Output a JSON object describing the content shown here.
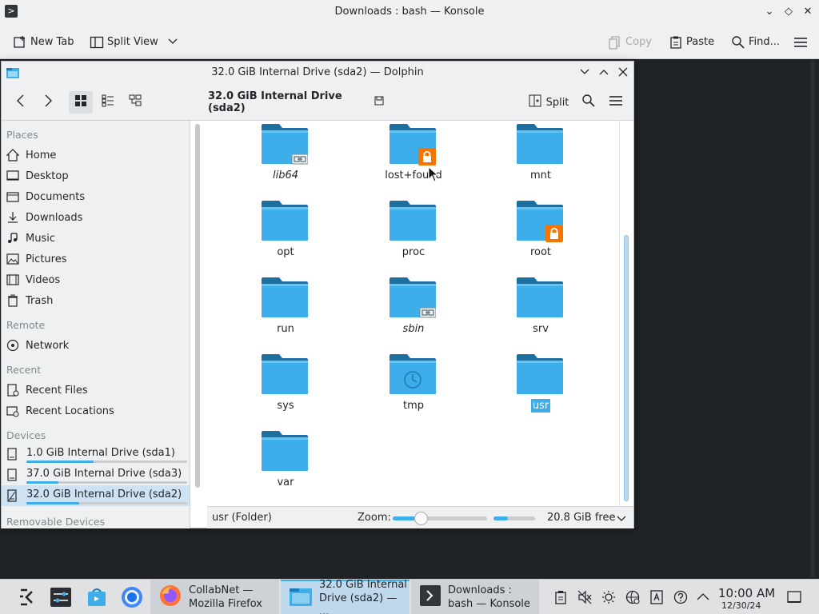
{
  "konsole": {
    "title": "Downloads : bash — Konsole",
    "toolbar": {
      "new_tab": "New Tab",
      "split_view": "Split View",
      "copy": "Copy",
      "paste": "Paste",
      "find": "Find..."
    }
  },
  "dolphin": {
    "title": "32.0 GiB Internal Drive (sda2) — Dolphin",
    "breadcrumb": "32.0 GiB Internal Drive (sda2)",
    "toolbar": {
      "split": "Split"
    },
    "sidebar": {
      "places_header": "Places",
      "places": [
        "Home",
        "Desktop",
        "Documents",
        "Downloads",
        "Music",
        "Pictures",
        "Videos",
        "Trash"
      ],
      "remote_header": "Remote",
      "remote": [
        "Network"
      ],
      "recent_header": "Recent",
      "recent": [
        "Recent Files",
        "Recent Locations"
      ],
      "devices_header": "Devices",
      "devices": [
        {
          "label": "1.0 GiB Internal Drive (sda1)",
          "usage": 0.42
        },
        {
          "label": "37.0 GiB Internal Drive (sda3)",
          "usage": 0.2
        },
        {
          "label": "32.0 GiB Internal Drive (sda2)",
          "usage": 0.33
        }
      ],
      "removable_header": "Removable Devices"
    },
    "folders": [
      {
        "name": "lib64",
        "italic": true,
        "badge": "symlink"
      },
      {
        "name": "lost+found",
        "italic": false,
        "badge": "lock"
      },
      {
        "name": "mnt",
        "italic": false,
        "badge": ""
      },
      {
        "name": "opt",
        "italic": false,
        "badge": ""
      },
      {
        "name": "proc",
        "italic": false,
        "badge": ""
      },
      {
        "name": "root",
        "italic": false,
        "badge": "lock"
      },
      {
        "name": "run",
        "italic": false,
        "badge": ""
      },
      {
        "name": "sbin",
        "italic": true,
        "badge": "symlink"
      },
      {
        "name": "srv",
        "italic": false,
        "badge": ""
      },
      {
        "name": "sys",
        "italic": false,
        "badge": ""
      },
      {
        "name": "tmp",
        "italic": false,
        "badge": "clock"
      },
      {
        "name": "usr",
        "italic": false,
        "badge": "",
        "selected": true
      },
      {
        "name": "var",
        "italic": false,
        "badge": ""
      }
    ],
    "statusbar": {
      "status": "usr (Folder)",
      "zoom_label": "Zoom:",
      "zoom_level": 0.3,
      "free_space": "20.8 GiB free",
      "used_fraction": 0.35
    }
  },
  "taskbar": {
    "tasks": [
      {
        "line1": "CollabNet —",
        "line2": "Mozilla Firefox"
      },
      {
        "line1": "32.0 GiB Internal",
        "line2": "Drive (sda2) — ..."
      },
      {
        "line1": "Downloads :",
        "line2": "bash — Konsole"
      }
    ],
    "clock_time": "10:00 AM",
    "clock_date": "12/30/24"
  },
  "colors": {
    "accent": "#3daee9",
    "folder": "#3daee9",
    "folder_tab": "#1d7ab3",
    "lock": "#f67400"
  }
}
